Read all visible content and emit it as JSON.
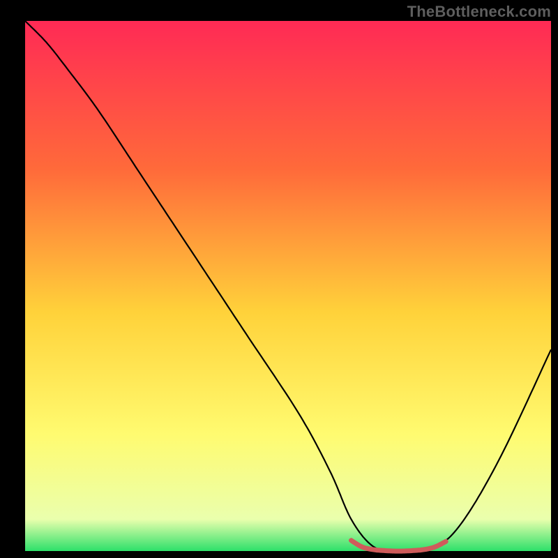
{
  "watermark": "TheBottleneck.com",
  "chart_data": {
    "type": "line",
    "title": "",
    "xlabel": "",
    "ylabel": "",
    "xlim": [
      0,
      100
    ],
    "ylim": [
      0,
      100
    ],
    "grid": false,
    "legend": false,
    "background_gradient_stops": [
      {
        "offset": 0.0,
        "color": "#ff2a55"
      },
      {
        "offset": 0.28,
        "color": "#ff6a3a"
      },
      {
        "offset": 0.55,
        "color": "#ffd23a"
      },
      {
        "offset": 0.78,
        "color": "#fffb70"
      },
      {
        "offset": 0.94,
        "color": "#eaffad"
      },
      {
        "offset": 1.0,
        "color": "#2de06a"
      }
    ],
    "series": [
      {
        "name": "bottleneck-curve",
        "color": "#000000",
        "stroke_width": 2.2,
        "x": [
          0,
          4,
          8,
          14,
          22,
          32,
          42,
          52,
          58,
          62,
          66,
          70,
          76,
          82,
          90,
          100
        ],
        "y": [
          100,
          96,
          91,
          83,
          71,
          56,
          41,
          26,
          15,
          6,
          1,
          0,
          0,
          4,
          17,
          38
        ]
      },
      {
        "name": "sweet-spot-band",
        "color": "#cf5b5b",
        "stroke_width": 7,
        "x": [
          62,
          64,
          66,
          68,
          70,
          72,
          74,
          76,
          78,
          80
        ],
        "y": [
          2,
          0.8,
          0.3,
          0.1,
          0,
          0,
          0.1,
          0.3,
          0.8,
          1.8
        ]
      }
    ],
    "annotations": []
  }
}
